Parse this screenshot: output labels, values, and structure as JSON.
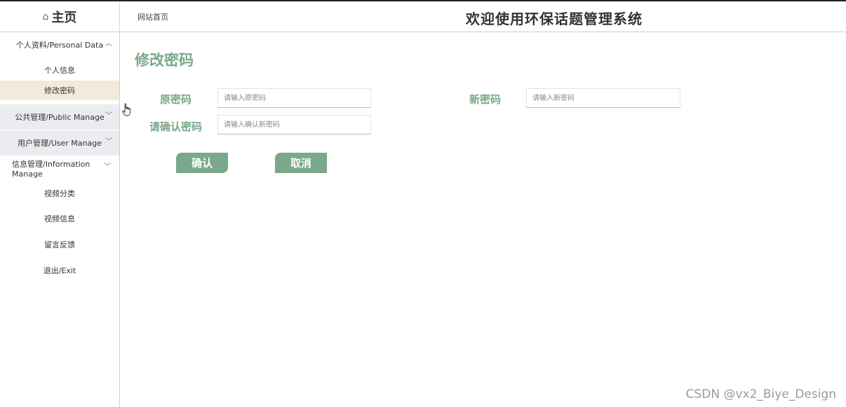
{
  "header": {
    "home_icon": "home-icon",
    "logo_text": "主页",
    "breadcrumb": "网站首页",
    "system_title": "欢迎使用环保话题管理系统"
  },
  "sidebar": {
    "personal": {
      "label": "个人资料/Personal Data",
      "chevron": "^"
    },
    "personal_items": [
      "个人信息",
      "修改密码"
    ],
    "public_manage": {
      "label": "公共管理/Public Manage",
      "chevron": "﹀"
    },
    "user_manage": {
      "label": "用户管理/User Manage",
      "chevron": "﹀"
    },
    "info_manage": {
      "label": "信息管理/Information Manage",
      "chevron": "﹀"
    },
    "info_items": [
      "视频分类",
      "视频信息",
      "留言反馈"
    ],
    "exit": "退出/Exit",
    "active_color": "#f3eadb"
  },
  "main": {
    "page_title": "修改密码",
    "old_password": {
      "label": "原密码",
      "placeholder": "请输入原密码"
    },
    "new_password": {
      "label": "新密码",
      "placeholder": "请输入新密码"
    },
    "confirm_password": {
      "label": "请确认密码",
      "placeholder": "请输入确认新密码"
    },
    "confirm_button": "确认",
    "cancel_button": "取消",
    "accent_color": "#7aa88a"
  },
  "watermark": "CSDN @vx2_Biye_Design"
}
